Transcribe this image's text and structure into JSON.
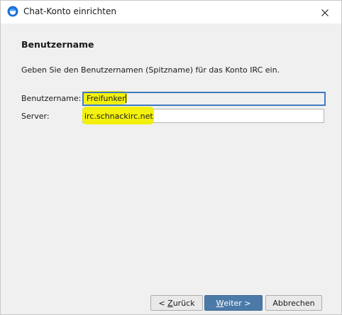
{
  "window": {
    "title": "Chat-Konto einrichten"
  },
  "page": {
    "title": "Benutzername",
    "description": "Geben Sie den Benutzernamen (Spitzname) für das Konto IRC ein."
  },
  "form": {
    "username_label": "Benutzername:",
    "username_value": "Freifunker",
    "server_label": "Server:",
    "server_value": "irc.schnackirc.net"
  },
  "buttons": {
    "back_prefix": "< ",
    "back_underlined": "Z",
    "back_rest": "urück",
    "next_underlined": "W",
    "next_rest": "eiter >",
    "cancel": "Abbrechen"
  },
  "colors": {
    "highlight": "#f2f000",
    "primary_button": "#4c7aa8",
    "focus_border": "#3f7bbf"
  },
  "icons": {
    "app": "thunderbird-icon",
    "close": "close-icon"
  }
}
